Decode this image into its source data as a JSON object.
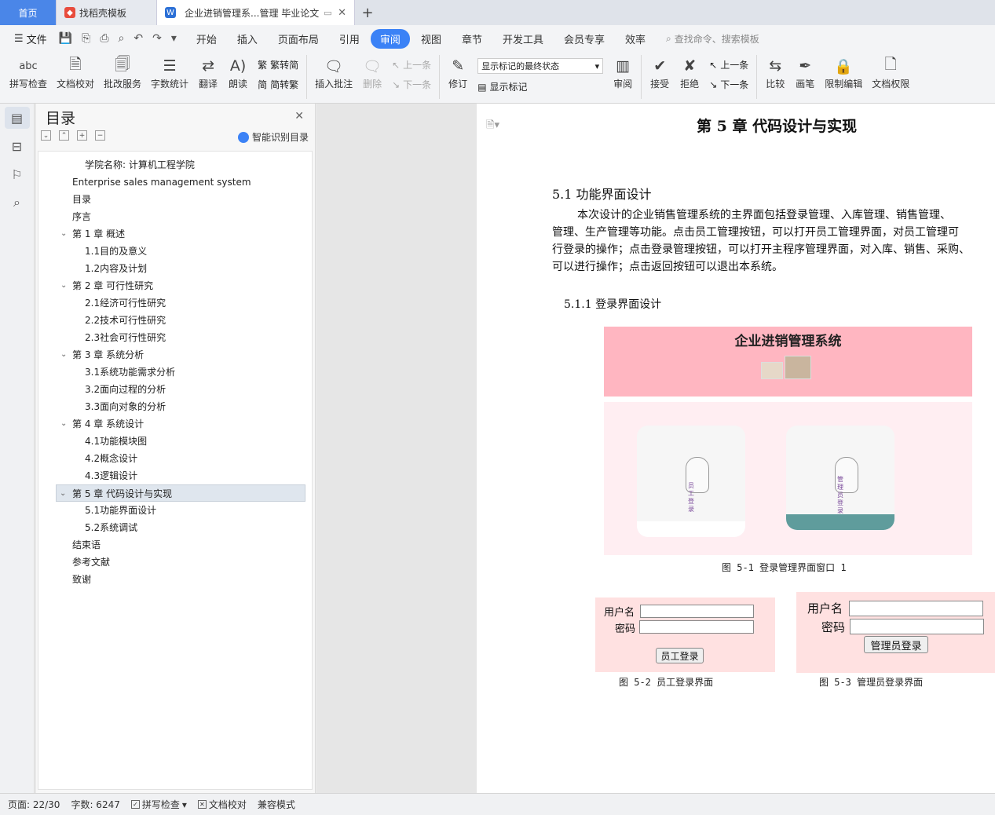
{
  "tabs": {
    "home": "首页",
    "template": "找稻壳模板",
    "doc": "企业进销管理系...管理 毕业论文"
  },
  "menu": {
    "file": "文件",
    "items": [
      "开始",
      "插入",
      "页面布局",
      "引用",
      "审阅",
      "视图",
      "章节",
      "开发工具",
      "会员专享",
      "效率"
    ],
    "search": "查找命令、搜索模板"
  },
  "ribbon": {
    "spell": "拼写检查",
    "doc_check": "文档校对",
    "batch": "批改服务",
    "word_count": "字数统计",
    "translate": "翻译",
    "read": "朗读",
    "trad_to_simp": "繁转简",
    "simp_to_trad": "简转繁",
    "insert_comment": "插入批注",
    "delete": "删除",
    "prev": "上一条",
    "next": "下一条",
    "revise": "修订",
    "markup_state": "显示标记的最终状态",
    "show_markup": "显示标记",
    "review": "审阅",
    "accept": "接受",
    "reject": "拒绝",
    "prev2": "上一条",
    "next2": "下一条",
    "compare": "比较",
    "pen": "画笔",
    "restrict": "限制编辑",
    "permission": "文档权限"
  },
  "toc": {
    "title": "目录",
    "smart": "智能识别目录",
    "items": [
      {
        "text": "学院名称:    计算机工程学院",
        "level": 1
      },
      {
        "text": "Enterprise sales management system",
        "level": 0
      },
      {
        "text": "目录",
        "level": 0
      },
      {
        "text": "序言",
        "level": 0
      },
      {
        "text": "第 1 章  概述",
        "level": 0,
        "arrow": true
      },
      {
        "text": "1.1目的及意义",
        "level": 1
      },
      {
        "text": "1.2内容及计划",
        "level": 1
      },
      {
        "text": "第 2 章  可行性研究",
        "level": 0,
        "arrow": true
      },
      {
        "text": "2.1经济可行性研究",
        "level": 1
      },
      {
        "text": "2.2技术可行性研究",
        "level": 1
      },
      {
        "text": "2.3社会可行性研究",
        "level": 1
      },
      {
        "text": "第 3 章  系统分析",
        "level": 0,
        "arrow": true
      },
      {
        "text": "3.1系统功能需求分析",
        "level": 1
      },
      {
        "text": "3.2面向过程的分析",
        "level": 1
      },
      {
        "text": "3.3面向对象的分析",
        "level": 1
      },
      {
        "text": "第 4 章  系统设计",
        "level": 0,
        "arrow": true
      },
      {
        "text": "4.1功能模块图",
        "level": 1
      },
      {
        "text": "4.2概念设计",
        "level": 1
      },
      {
        "text": "4.3逻辑设计",
        "level": 1
      },
      {
        "text": "第 5 章  代码设计与实现",
        "level": 0,
        "arrow": true,
        "selected": true
      },
      {
        "text": "5.1功能界面设计",
        "level": 1
      },
      {
        "text": "5.2系统调试",
        "level": 1
      },
      {
        "text": "结束语",
        "level": 0
      },
      {
        "text": "参考文献",
        "level": 0
      },
      {
        "text": "致谢",
        "level": 0
      }
    ]
  },
  "doc": {
    "chapter": "第 5 章    代码设计与实现",
    "section": "5.1    功能界面设计",
    "para_lines": [
      "本次设计的企业销售管理系统的主界面包括登录管理、入库管理、销售管理、",
      "管理、生产管理等功能。点击员工管理按钮，可以打开员工管理界面，对员工管理可",
      "行登录的操作；点击登录管理按钮，可以打开主程序管理界面，对入库、销售、采购、",
      "可以进行操作；点击返回按钮可以退出本系统。"
    ],
    "subsection": "5.1.1    登录界面设计",
    "fig1_title": "企业进销管理系统",
    "fig1_card_a": "员工登录",
    "fig1_card_b": "管理员登录",
    "fig1_caption": "图 5-1 登录管理界面窗口 1",
    "fig2": {
      "user": "用户名",
      "pwd": "密码",
      "btn": "员工登录",
      "caption": "图 5-2 员工登录界面"
    },
    "fig3": {
      "user": "用户名",
      "pwd": "密码",
      "btn": "管理员登录",
      "caption": "图 5-3 管理员登录界面"
    }
  },
  "status": {
    "page": "页面: 22/30",
    "words": "字数: 6247",
    "spell": "拼写检查",
    "check": "文档校对",
    "compat": "兼容模式"
  },
  "colors": {
    "accent": "#3b82f6",
    "fig_header": "#ffb6c1",
    "fig_body": "#ffeef2",
    "login_bg": "#ffe1e1",
    "teal": "#5f9c9c"
  }
}
